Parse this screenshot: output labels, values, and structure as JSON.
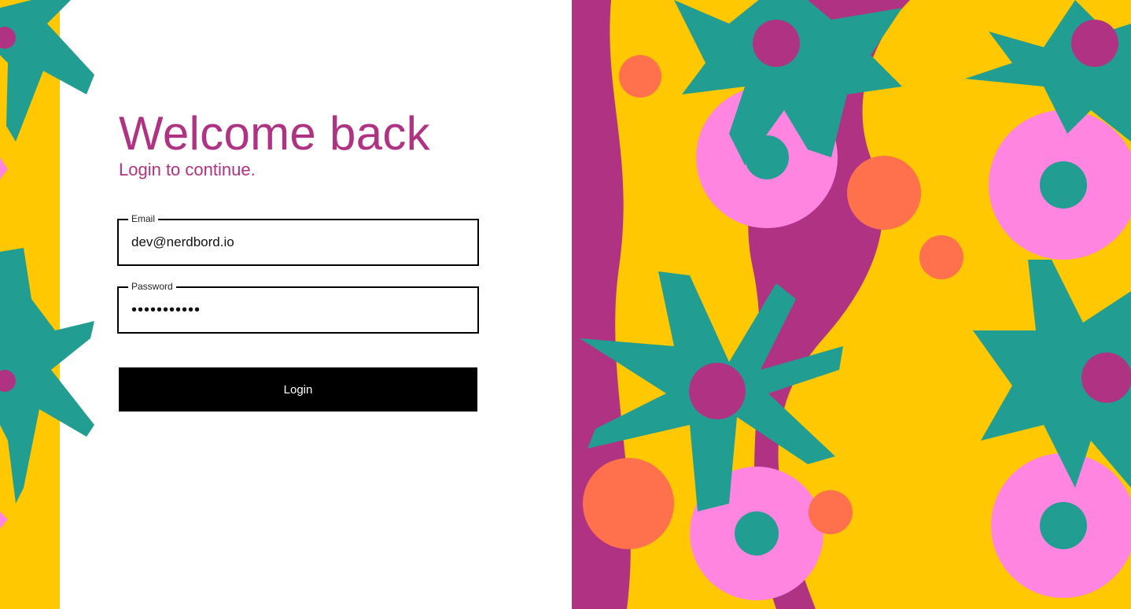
{
  "header": {
    "title": "Welcome back",
    "subtitle": "Login to continue."
  },
  "form": {
    "email": {
      "label": "Email",
      "value": "dev@nerdbord.io"
    },
    "password": {
      "label": "Password",
      "value": "•••••••••••"
    },
    "submit_label": "Login"
  },
  "colors": {
    "accent": "#b03283",
    "button": "#000000",
    "art_yellow": "#ffc800",
    "art_magenta": "#b03283",
    "art_teal": "#219e91",
    "art_pink": "#ff85e0",
    "art_orange": "#ff704d"
  }
}
